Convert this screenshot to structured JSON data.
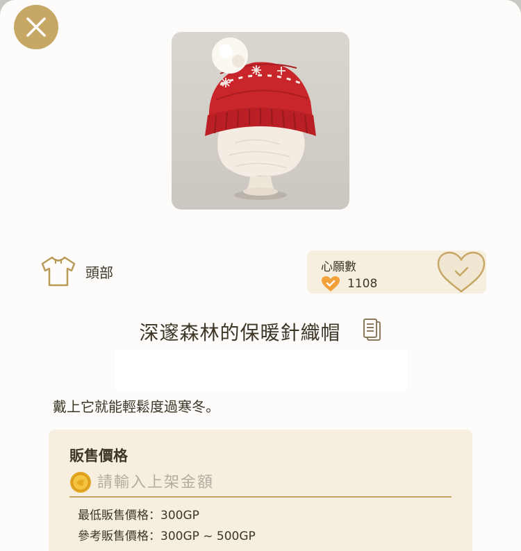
{
  "icons": {
    "close": "close-icon",
    "category": "shirt-icon",
    "wish_count": "heart-check-badge-icon",
    "wish_button": "heart-check-icon",
    "copy": "copy-icon",
    "coin": "gold-coin-icon"
  },
  "item": {
    "category_label": "頭部",
    "name": "深邃森林的保暖針織帽",
    "description": "戴上它就能輕鬆度過寒冬。"
  },
  "wish": {
    "title": "心願數",
    "count": "1108"
  },
  "price": {
    "title": "販售價格",
    "input_value": "",
    "input_placeholder": "請輸入上架金額",
    "min_price": "最低販售價格：300GP",
    "reference_price": "參考販售價格：300GP ~ 500GP"
  },
  "colors": {
    "accent_gold": "#c7a766",
    "panel_beige": "#f6efe0",
    "heart_orange": "#f2a03a",
    "hat_red": "#c9262b",
    "text_dark": "#3d3526"
  }
}
